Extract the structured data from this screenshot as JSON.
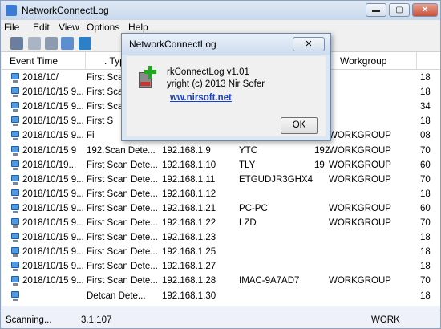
{
  "window": {
    "title": "NetworkConnectLog",
    "controls": {
      "minimize": "▬",
      "maximize": "▢",
      "close": "✕"
    }
  },
  "menu": [
    "File",
    "Edit",
    "View",
    "Options",
    "Help"
  ],
  "toolbar": {
    "buttons": [
      "save-icon",
      "copy-icon",
      "html-report-icon",
      "properties-icon",
      "exit-icon"
    ]
  },
  "table": {
    "columns": [
      "Event Time",
      ". Typ",
      "",
      "",
      "",
      "Workgroup",
      ""
    ],
    "rows": [
      {
        "time": "2018/10/",
        "type": "First Scan",
        "ip": "",
        "host": "",
        "mac": "",
        "workgroup": "",
        "extra": "18"
      },
      {
        "time": "2018/10/15 9...",
        "type": "First Scan",
        "ip": "",
        "host": "",
        "mac": "",
        "workgroup": "",
        "extra": "18"
      },
      {
        "time": "2018/10/15 9...",
        "type": "First Scan",
        "ip": "",
        "host": "",
        "mac": "",
        "workgroup": "",
        "extra": "34"
      },
      {
        "time": "2018/10/15 9...",
        "type": "First S",
        "ip": "",
        "host": "",
        "mac": "",
        "workgroup": "",
        "extra": "18"
      },
      {
        "time": "2018/10/15 9...",
        "type": "Fi",
        "ip": "",
        "host": "",
        "mac": "",
        "workgroup": "WORKGROUP",
        "extra": "08"
      },
      {
        "time": "2018/10/15 9",
        "type": "192.Scan Dete...",
        "ip": "192.168.1.9",
        "host": "YTC",
        "mac": "192",
        "workgroup": "WORKGROUP",
        "extra": "70"
      },
      {
        "time": "2018/10/19...",
        "type": "First Scan Dete...",
        "ip": "192.168.1.10",
        "host": "TLY",
        "mac": "19",
        "workgroup": "WORKGROUP",
        "extra": "60"
      },
      {
        "time": "2018/10/15 9...",
        "type": "First Scan Dete...",
        "ip": "192.168.1.11",
        "host": "ETGUDJR3GHX4",
        "mac": "",
        "workgroup": "WORKGROUP",
        "extra": "70"
      },
      {
        "time": "2018/10/15 9...",
        "type": "First Scan Dete...",
        "ip": "192.168.1.12",
        "host": "",
        "mac": "",
        "workgroup": "",
        "extra": "18"
      },
      {
        "time": "2018/10/15 9...",
        "type": "First Scan Dete...",
        "ip": "192.168.1.21",
        "host": "PC-PC",
        "mac": "",
        "workgroup": "WORKGROUP",
        "extra": "60"
      },
      {
        "time": "2018/10/15 9...",
        "type": "First Scan Dete...",
        "ip": "192.168.1.22",
        "host": "LZD",
        "mac": "",
        "workgroup": "WORKGROUP",
        "extra": "70"
      },
      {
        "time": "2018/10/15 9...",
        "type": "First Scan Dete...",
        "ip": "192.168.1.23",
        "host": "",
        "mac": "",
        "workgroup": "",
        "extra": "18"
      },
      {
        "time": "2018/10/15 9...",
        "type": "First Scan Dete...",
        "ip": "192.168.1.25",
        "host": "",
        "mac": "",
        "workgroup": "",
        "extra": "18"
      },
      {
        "time": "2018/10/15 9...",
        "type": "First Scan Dete...",
        "ip": "192.168.1.27",
        "host": "",
        "mac": "",
        "workgroup": "",
        "extra": "18"
      },
      {
        "time": "2018/10/15 9...",
        "type": "First Scan Dete...",
        "ip": "192.168.1.28",
        "host": "IMAC-9A7AD7",
        "mac": "",
        "workgroup": "WORKGROUP",
        "extra": "70"
      },
      {
        "time": "",
        "type": "Detcan Dete...",
        "ip": "192.168.1.30",
        "host": "",
        "mac": "",
        "workgroup": "",
        "extra": "18"
      }
    ]
  },
  "status": {
    "text": "Scanning...",
    "ip_fragment": "3.1.107",
    "right_fragment": "WORK"
  },
  "dialog": {
    "title": "NetworkConnectLog",
    "close": "✕",
    "version_line": "rkConnectLog v1.01",
    "copyright_line": "yright (c) 2013 Nir Sofer",
    "link": "ww.nirsoft.net",
    "ok": "OK"
  }
}
